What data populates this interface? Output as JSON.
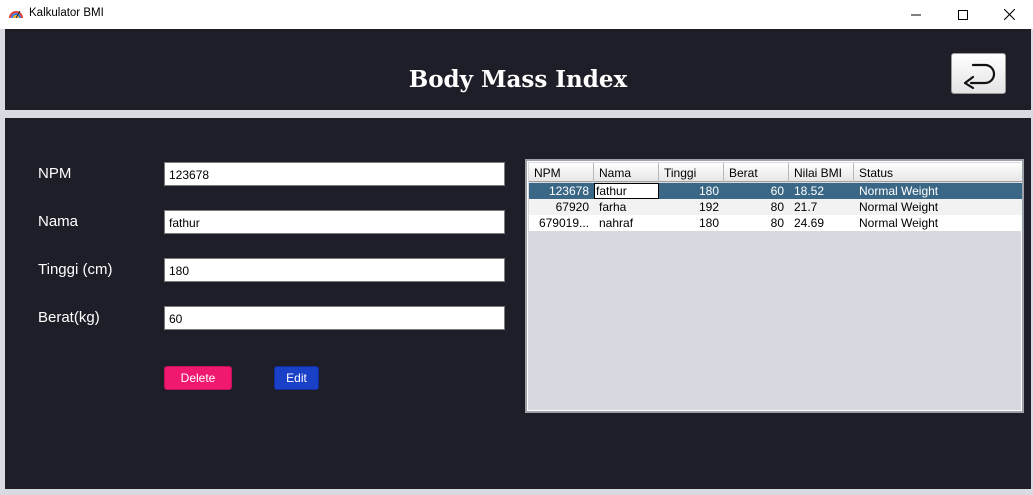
{
  "window": {
    "title": "Kalkulator BMI",
    "icon": "app-logo-icon"
  },
  "header": {
    "title": "Body Mass Index",
    "back_icon": "return-arrow-icon"
  },
  "form": {
    "npm_label": "NPM",
    "npm_value": "123678",
    "nama_label": "Nama",
    "nama_value": "fathur",
    "tinggi_label": "Tinggi (cm)",
    "tinggi_value": "180",
    "berat_label": "Berat(kg)",
    "berat_value": "60"
  },
  "buttons": {
    "delete_label": "Delete",
    "edit_label": "Edit"
  },
  "table": {
    "columns": [
      "NPM",
      "Nama",
      "Tinggi",
      "Berat",
      "Nilai BMI",
      "Status"
    ],
    "rows": [
      {
        "npm": "123678",
        "nama": "fathur",
        "tinggi": "180",
        "berat": "60",
        "bmi": "18.52",
        "status": "Normal Weight"
      },
      {
        "npm": "67920",
        "nama": "farha",
        "tinggi": "192",
        "berat": "80",
        "bmi": "21.7",
        "status": "Normal Weight"
      },
      {
        "npm": "679019...",
        "nama": "nahraf",
        "tinggi": "180",
        "berat": "80",
        "bmi": "24.69",
        "status": "Normal Weight"
      }
    ]
  },
  "colors": {
    "background": "#1e1e28",
    "delete": "#f0186f",
    "edit": "#1a40c8",
    "selected_row": "#3a6786"
  }
}
